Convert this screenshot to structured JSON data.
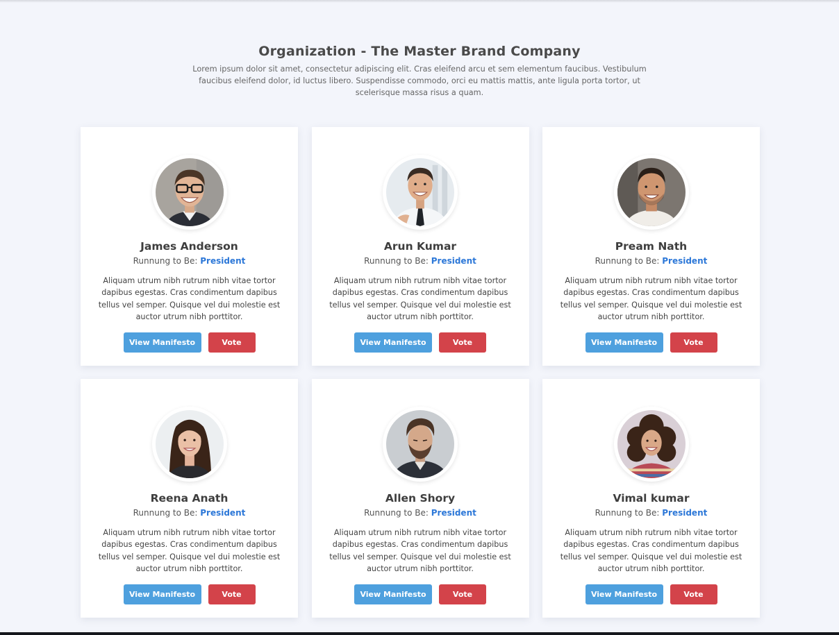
{
  "header": {
    "title": "Organization - The Master Brand Company",
    "subtitle": "Lorem ipsum dolor sit amet, consectetur adipiscing elit. Cras eleifend arcu et sem elementum faucibus. Vestibulum faucibus eleifend dolor, id luctus libero. Suspendisse commodo, orci eu mattis mattis, ante ligula porta tortor, ut scelerisque massa risus a quam."
  },
  "colors": {
    "page_bg": "#f3f5fb",
    "office_link": "#2d78d8",
    "manifesto_button": "#4ea0de",
    "vote_button": "#d3434a"
  },
  "candidates": [
    {
      "name": "James Anderson",
      "running_label": "Runnung to Be:",
      "office": "President",
      "description": "Aliquam utrum nibh rutrum nibh vitae tortor dapibus egestas. Cras condimentum dapibus tellus vel semper. Quisque vel dui molestie est auctor utrum nibh porttitor.",
      "manifesto_label": "View Manifesto",
      "vote_label": "Vote"
    },
    {
      "name": "Arun Kumar",
      "running_label": "Runnung to Be:",
      "office": "President",
      "description": "Aliquam utrum nibh rutrum nibh vitae tortor dapibus egestas. Cras condimentum dapibus tellus vel semper. Quisque vel dui molestie est auctor utrum nibh porttitor.",
      "manifesto_label": "View Manifesto",
      "vote_label": "Vote"
    },
    {
      "name": "Pream Nath",
      "running_label": "Runnung to Be:",
      "office": "President",
      "description": "Aliquam utrum nibh rutrum nibh vitae tortor dapibus egestas. Cras condimentum dapibus tellus vel semper. Quisque vel dui molestie est auctor utrum nibh porttitor.",
      "manifesto_label": "View Manifesto",
      "vote_label": "Vote"
    },
    {
      "name": "Reena Anath",
      "running_label": "Runnung to Be:",
      "office": "President",
      "description": "Aliquam utrum nibh rutrum nibh vitae tortor dapibus egestas. Cras condimentum dapibus tellus vel semper. Quisque vel dui molestie est auctor utrum nibh porttitor.",
      "manifesto_label": "View Manifesto",
      "vote_label": "Vote"
    },
    {
      "name": "Allen Shory",
      "running_label": "Runnung to Be:",
      "office": "President",
      "description": "Aliquam utrum nibh rutrum nibh vitae tortor dapibus egestas. Cras condimentum dapibus tellus vel semper. Quisque vel dui molestie est auctor utrum nibh porttitor.",
      "manifesto_label": "View Manifesto",
      "vote_label": "Vote"
    },
    {
      "name": "Vimal kumar",
      "running_label": "Runnung to Be:",
      "office": "President",
      "description": "Aliquam utrum nibh rutrum nibh vitae tortor dapibus egestas. Cras condimentum dapibus tellus vel semper. Quisque vel dui molestie est auctor utrum nibh porttitor.",
      "manifesto_label": "View Manifesto",
      "vote_label": "Vote"
    }
  ]
}
